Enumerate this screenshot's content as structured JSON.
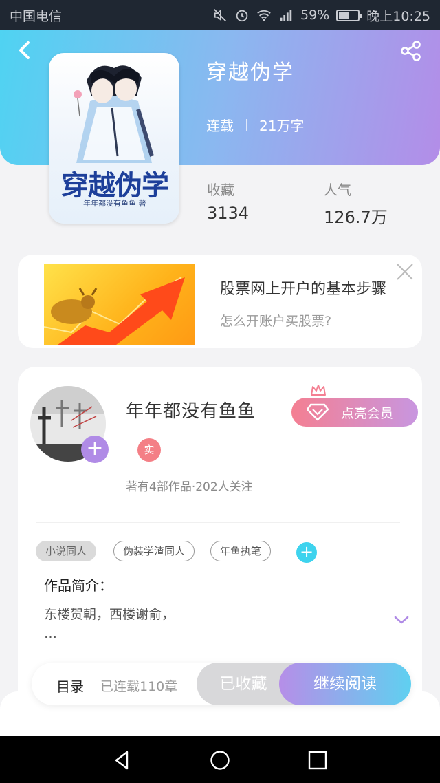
{
  "status_bar": {
    "carrier": "中国电信",
    "battery_percent": "59%",
    "time": "晚上10:25",
    "battery_level": 0.59,
    "icons": [
      "mute-icon",
      "alarm-icon",
      "wifi-icon",
      "signal-icon",
      "battery-icon"
    ]
  },
  "header": {
    "icons": [
      "back-icon",
      "share-icon"
    ],
    "gradient": [
      "#4fd3f2",
      "#b38de8"
    ]
  },
  "book": {
    "title": "穿越伪学",
    "status": "连载",
    "word_count": "21万字",
    "cover_title": "穿越伪学",
    "cover_author": "年年都没有鱼鱼 著",
    "stats": [
      {
        "label": "收藏",
        "value": "3134"
      },
      {
        "label": "人气",
        "value": "126.7万"
      }
    ]
  },
  "ad": {
    "title": "股票网上开户的基本步骤",
    "subtitle": "怎么开账户买股票?",
    "icons": [
      "close-icon"
    ]
  },
  "author": {
    "name": "年年都没有鱼鱼",
    "badge": "实",
    "info": "著有4部作品·202人关注",
    "follow_symbol": "+",
    "vip_label": "点亮会员"
  },
  "tags": {
    "items": [
      "小说同人",
      "伪装学渣同人",
      "年鱼执笔"
    ],
    "add_symbol": "+"
  },
  "intro": {
    "title": "作品简介：",
    "line1": "东楼贺朝，西楼谢俞，",
    "line2": "…"
  },
  "bottom_bar": {
    "toc_label": "目录",
    "chapter_count": "已连载110章",
    "collect_label": "已收藏",
    "read_label": "继续阅读"
  },
  "nav": {
    "icons": [
      "back-nav-icon",
      "home-nav-icon",
      "recents-nav-icon"
    ]
  }
}
